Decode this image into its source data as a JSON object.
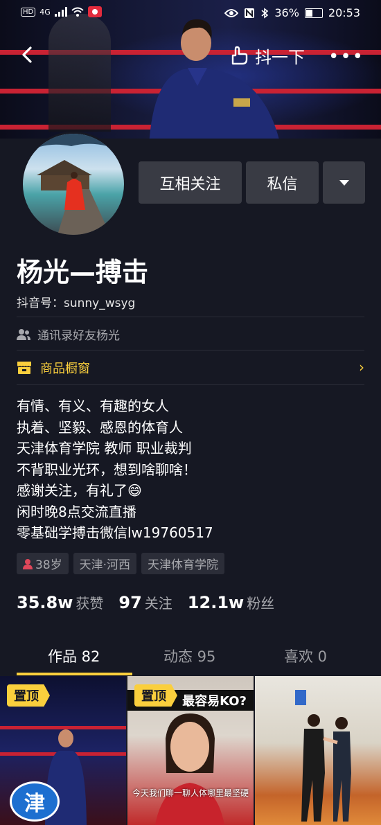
{
  "status_bar": {
    "hd": "HD",
    "network": "4G",
    "battery_text": "36%",
    "time": "20:53"
  },
  "nav": {
    "shake_label": "抖一下"
  },
  "actions": {
    "follow_label": "互相关注",
    "message_label": "私信"
  },
  "profile": {
    "name": "杨光—搏击",
    "douyin_id": "抖音号：sunny_wsyg",
    "contact_hint": "通讯录好友杨光",
    "shop_label": "商品橱窗"
  },
  "bio": [
    "有情、有义、有趣的女人",
    "执着、坚毅、感恩的体育人",
    "天津体育学院  教师  职业裁判",
    "不背职业光环，想到啥聊啥！",
    "感谢关注，有礼了😄",
    "闲时晚8点交流直播",
    "零基础学搏击微信lw19760517"
  ],
  "tags": {
    "age": "38岁",
    "location": "天津·河西",
    "school": "天津体育学院"
  },
  "stats": {
    "likes_num": "35.8w",
    "likes_label": "获赞",
    "following_num": "97",
    "following_label": "关注",
    "fans_num": "12.1w",
    "fans_label": "粉丝"
  },
  "tabs": {
    "works": "作品 82",
    "dynamics": "动态 95",
    "likes": "喜欢 0"
  },
  "videos": {
    "pin_label": "置顶",
    "v2_headline": "最容易KO?",
    "v2_caption": "今天我们聊一聊人体哪里最坚硬",
    "v1_logo_text": "津"
  },
  "colors": {
    "background": "#161823",
    "accent_yellow": "#facf3d",
    "button_gray": "#393b44",
    "muted_text": "#a7a8ad",
    "age_icon": "#e0475a"
  }
}
